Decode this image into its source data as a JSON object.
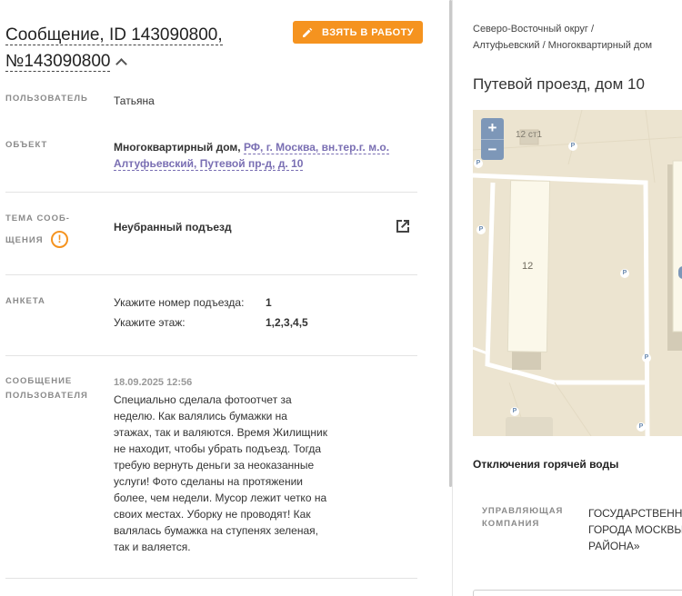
{
  "header": {
    "title_line1": "Сообщение, ID 143090800,",
    "title_line2": "№143090800",
    "take_button_label": "ВЗЯТЬ В РАБОТУ"
  },
  "fields": {
    "user_label": "ПОЛЬЗОВАТЕЛЬ",
    "user_value": "Татьяна",
    "object_label": "ОБЪЕКТ",
    "object_type": "Многоквартирный дом,",
    "object_address_line1": "РФ, г. Москва, вн.тер.г. м.о.",
    "object_address_line2": "Алтуфьевский, Путевой пр-д, д. 10",
    "topic_label_line1": "ТЕМА СООБ-",
    "topic_label_line2": "ЩЕНИЯ",
    "topic_value": "Неубранный подъезд",
    "survey_label": "АНКЕТА",
    "survey_rows": [
      {
        "question": "Укажите номер подъезда:",
        "answer": "1"
      },
      {
        "question": "Укажите этаж:",
        "answer": "1,2,3,4,5"
      }
    ],
    "message_label_line1": "СООБЩЕНИЕ",
    "message_label_line2": "ПОЛЬЗОВАТЕЛЯ",
    "message_date": "18.09.2025 12:56",
    "message_lines": [
      "Специально сделала фотоотчет за",
      "неделю. Как валялись бумажки на",
      "этажах, так и валяются. Время Жилищник",
      "не находит, чтобы убрать подъезд. Тогда",
      "требую вернуть деньги за неоказанные",
      "услуги! Фото сделаны на протяжении",
      "более, чем недели. Мусор лежит четко на",
      "своих местах. Уборку не проводят! Как",
      "валялась бумажка на ступенях зеленая,",
      "так и валяется."
    ]
  },
  "right": {
    "breadcrumb_line1": "Северо-Восточный округ /",
    "breadcrumb_line2": "Алтуфьевский / Многоквартирный дом",
    "address": "Путевой проезд, дом 10",
    "map": {
      "zoom_in": "+",
      "zoom_out": "−",
      "building_label_top": "12 ст1",
      "building_label_main": "12",
      "parking": "P"
    },
    "hot_water_title": "Отключения горячей воды",
    "company_label_line1": "УПРАВЛЯЮЩАЯ",
    "company_label_line2": "КОМПАНИЯ",
    "company_lines": [
      "ГОСУДАРСТВЕННОЕ",
      "ГОРОДА МОСКВЫ",
      "РАЙОНА»"
    ]
  },
  "colors": {
    "accent": "#f5931f",
    "link": "#7a6fb3",
    "map_bg": "#ece4d0",
    "zoom_bg": "#7d97b8"
  }
}
